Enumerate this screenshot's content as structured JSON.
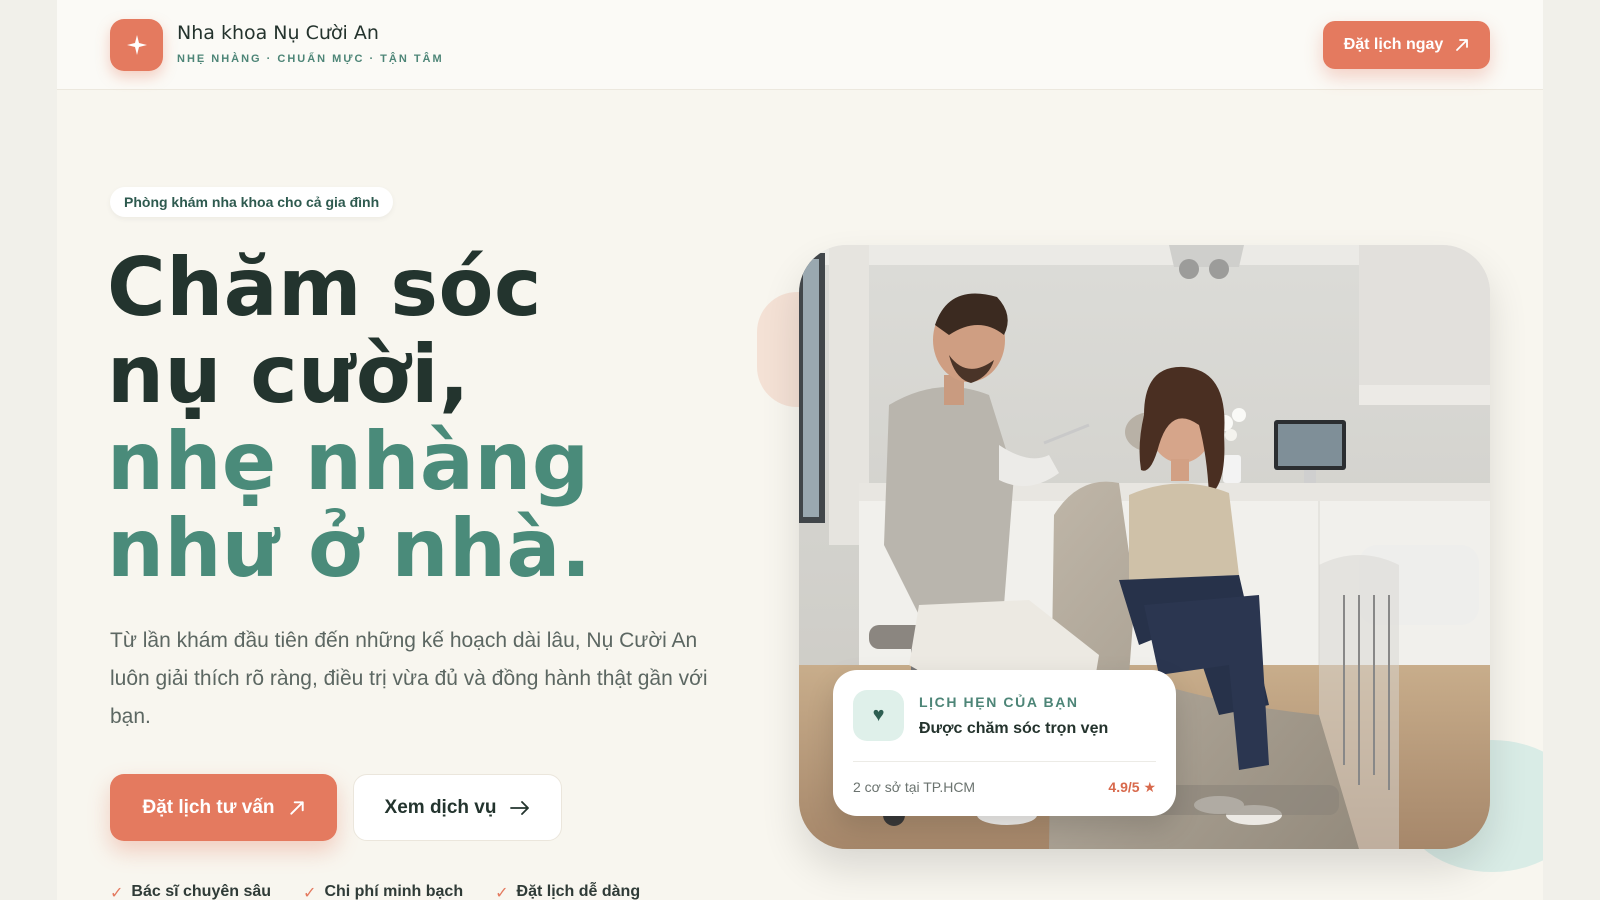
{
  "brand": {
    "name": "Nha khoa Nụ Cười An",
    "tagline": "NHẸ NHÀNG · CHUẨN MỰC · TẬN TÂM",
    "logo_icon": "sparkle-icon"
  },
  "header": {
    "cta_label": "Đặt lịch ngay",
    "cta_icon": "arrow-up-right-icon"
  },
  "hero": {
    "badge": "Phòng khám nha khoa cho cả gia đình",
    "headline_dark": [
      "Chăm sóc",
      "nụ cười,"
    ],
    "headline_green": [
      "nhẹ nhàng",
      "như ở nhà."
    ],
    "lead": "Từ lần khám đầu tiên đến những kế hoạch dài lâu, Nụ Cười An luôn giải thích rõ ràng, điều trị vừa đủ và đồng hành thật gần với bạn.",
    "primary_cta": "Đặt lịch tư vấn",
    "secondary_cta": "Xem dịch vụ",
    "secondary_cta_icon": "arrow-right-icon",
    "highlights": [
      "Bác sĩ chuyên sâu",
      "Chi phí minh bạch",
      "Đặt lịch dễ dàng"
    ]
  },
  "appointment_card": {
    "icon": "heart-icon",
    "kicker": "LỊCH HẸN CỦA BẠN",
    "title": "Được chăm sóc trọn vẹn",
    "meta": "2 cơ sở tại TP.HCM",
    "rating": "4.9/5 ★"
  },
  "colors": {
    "accent": "#e47a5f",
    "brand_green": "#4a8b7a",
    "text_dark": "#23342e",
    "background": "#f8f6ef"
  }
}
